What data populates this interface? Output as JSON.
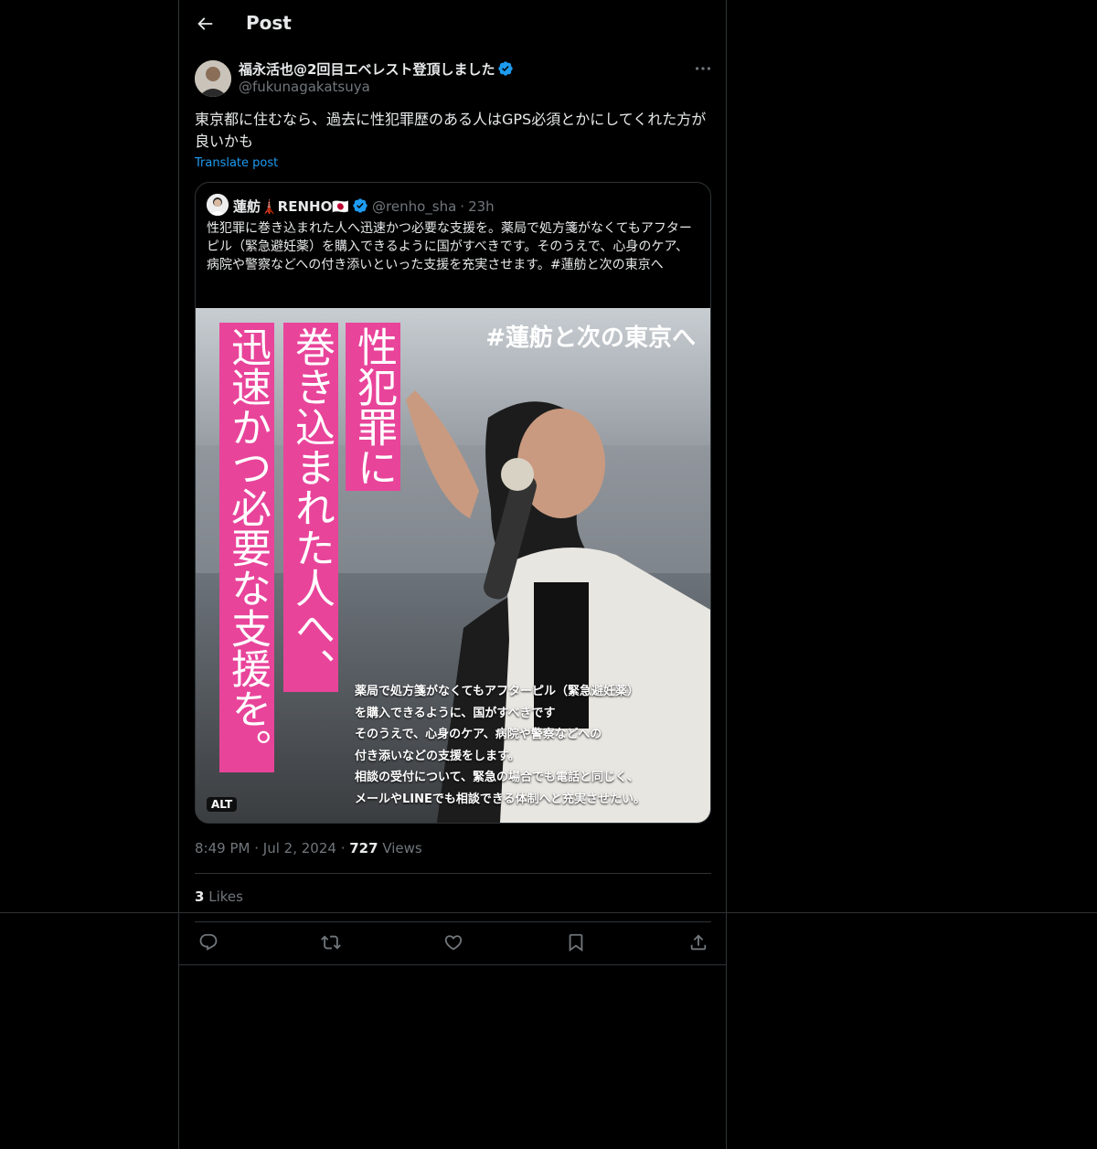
{
  "header": {
    "title": "Post"
  },
  "post": {
    "author_name": "福永活也@2回目エベレスト登頂しました",
    "author_handle": "@fukunagakatsuya",
    "text": "東京都に住むなら、過去に性犯罪歴のある人はGPS必須とかにしてくれた方が良いかも",
    "translate_label": "Translate post",
    "time": "8:49 PM",
    "date": "Jul 2, 2024",
    "views_count": "727",
    "views_label": "Views",
    "likes_count": "3",
    "likes_label": "Likes"
  },
  "quote": {
    "name": "蓮舫🗼RENHO🇯🇵",
    "handle": "@renho_sha",
    "age": "23h",
    "text": "性犯罪に巻き込まれた人へ迅速かつ必要な支援を。薬局で処方箋がなくてもアフターピル（緊急避妊薬）を購入できるように国がすべきです。そのうえで、心身のケア、病院や警察などへの付き添いといった支援を充実させます。#蓮舫と次の東京へ",
    "alt_badge": "ALT",
    "image": {
      "tag": "#蓮舫と次の東京へ",
      "col1": "性犯罪に",
      "col2": "巻き込まれた人へ、",
      "col3": "迅速かつ必要な支援を。",
      "caption_lines": [
        "薬局で処方箋がなくてもアフターピル（緊急避妊薬）",
        "を購入できるように、国がすべきです",
        "そのうえで、心身のケア、病院や警察などへの",
        "付き添いなどの支援をします。",
        "相談の受付について、緊急の場合でも電話と同じく、",
        "メールやLINEでも相談できる体制へと充実させたい。"
      ]
    }
  },
  "icons": {
    "back": "back-arrow-icon",
    "verified": "verified-badge-icon",
    "more": "more-icon",
    "reply": "reply-icon",
    "repost": "repost-icon",
    "like": "like-icon",
    "bookmark": "bookmark-icon",
    "share": "share-icon"
  },
  "colors": {
    "accent": "#1d9bf0",
    "muted": "#71767b",
    "text": "#e7e9ea",
    "border": "#2f3336",
    "pink": "#e8449a"
  }
}
